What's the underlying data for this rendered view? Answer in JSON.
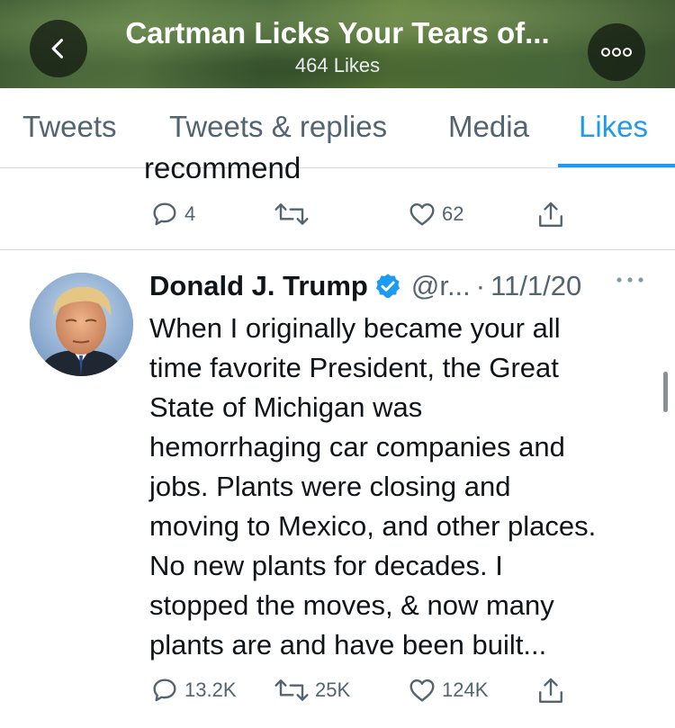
{
  "header": {
    "title": "Cartman Licks Your Tears of...",
    "subtitle": "464 Likes"
  },
  "tabs": [
    {
      "label": "Tweets"
    },
    {
      "label": "Tweets & replies"
    },
    {
      "label": "Media"
    },
    {
      "label": "Likes",
      "active": true
    }
  ],
  "previous_tweet": {
    "partial_text": "recommend",
    "replies": "4",
    "retweets": "",
    "likes": "62"
  },
  "tweet": {
    "author": "Donald J. Trump",
    "verified": true,
    "handle": "@r...",
    "separator": "·",
    "date": "11/1/20",
    "lines": [
      "When I originally became your all",
      "time favorite President, the Great",
      "State of Michigan was",
      "hemorrhaging car companies and",
      "jobs. Plants were closing and",
      "moving to Mexico, and other places.",
      "No new plants for decades. I",
      "stopped the moves, & now many",
      "plants are and have been built..."
    ],
    "replies": "13.2K",
    "retweets": "25K",
    "likes": "124K"
  },
  "colors": {
    "accent": "#1d9bf0",
    "secondary_text": "#536471",
    "verified_badge": "#1d9bf0"
  }
}
